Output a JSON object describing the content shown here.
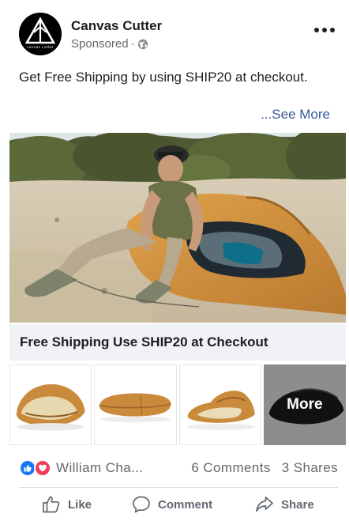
{
  "post": {
    "page_name": "Canvas Cutter",
    "sponsored_label": "Sponsored",
    "meta_separator": "·",
    "body_text": "Get Free Shipping by using SHIP20 at checkout.",
    "see_more": "...See More"
  },
  "logo": {
    "lettering": "canvas cutter"
  },
  "ad": {
    "headline": "Free Shipping Use SHIP20 at Checkout",
    "more_label": "More"
  },
  "engagement": {
    "reaction_names": "William Cha...",
    "comments": "6 Comments",
    "shares": "3 Shares"
  },
  "actions": {
    "like": "Like",
    "comment": "Comment",
    "share": "Share"
  },
  "icons": {
    "avatar": "canvas-cutter-logo",
    "privacy": "globe-icon",
    "menu": "more-options-icon",
    "like_reaction": "like-reaction-icon",
    "love_reaction": "love-reaction-icon",
    "like_action": "thumbs-up-icon",
    "comment_action": "comment-bubble-icon",
    "share_action": "share-arrow-icon"
  },
  "colors": {
    "link": "#385898",
    "secondary_text": "#65676b",
    "like_blue": "#1877f2",
    "love_red": "#f33e58",
    "product_tan": "#c98a3c"
  }
}
